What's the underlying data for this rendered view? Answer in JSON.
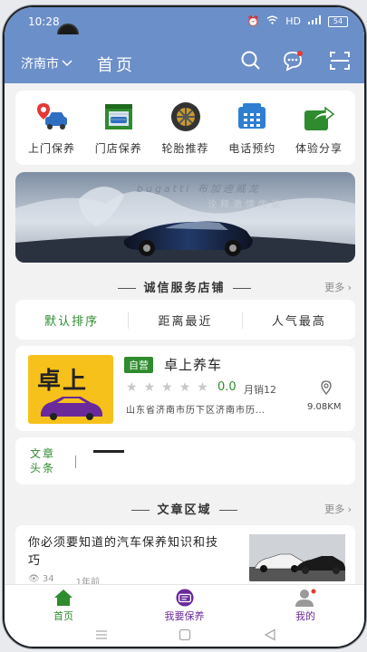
{
  "status_bar": {
    "time": "10:28",
    "network": "HD",
    "battery": "54"
  },
  "header": {
    "city": "济南市",
    "title": "首页"
  },
  "nav_grid": [
    {
      "label": "上门保养",
      "icon": "home-service-car-icon"
    },
    {
      "label": "门店保养",
      "icon": "store-garage-icon"
    },
    {
      "label": "轮胎推荐",
      "icon": "tire-icon"
    },
    {
      "label": "电话预约",
      "icon": "phone-icon"
    },
    {
      "label": "体验分享",
      "icon": "share-icon"
    }
  ],
  "banner": {
    "line1": "bugatti 布加迪威龙",
    "line2": "诠释激情传说"
  },
  "shops_section": {
    "title": "诚信服务店铺",
    "more": "更多"
  },
  "sort_options": [
    {
      "label": "默认排序",
      "active": true
    },
    {
      "label": "距离最近",
      "active": false
    },
    {
      "label": "人气最高",
      "active": false
    }
  ],
  "shop": {
    "logo_text": "卓上",
    "badge": "自营",
    "name": "卓上养车",
    "rating": "0.0",
    "stars": 0,
    "sales": "月销12",
    "address": "山东省济南市历下区济南市历…",
    "distance": "9.08KM"
  },
  "headlines": {
    "label": "文章头条"
  },
  "articles_section": {
    "title": "文章区域",
    "more": "更多"
  },
  "article": {
    "title": "你必须要知道的汽车保养知识和技巧",
    "views": "34",
    "time": "1年前"
  },
  "tabbar": [
    {
      "label": "首页",
      "active": true
    },
    {
      "label": "我要保养",
      "active": false
    },
    {
      "label": "我的",
      "active": false
    }
  ],
  "colors": {
    "header": "#6b8fc8",
    "accent_green": "#2e8b2e",
    "logo_yellow": "#f7c11b",
    "tab_purple": "#6a2a9a"
  }
}
